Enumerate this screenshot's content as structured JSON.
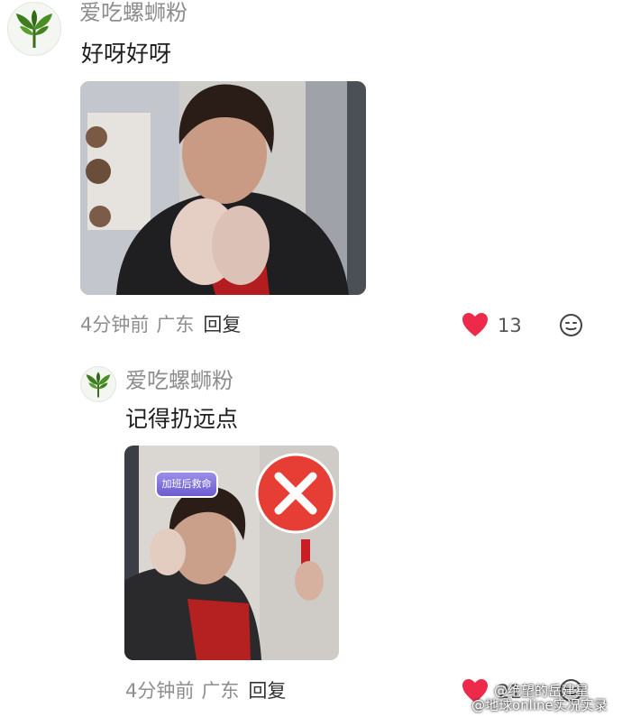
{
  "comments": [
    {
      "username": "爱吃螺蛳粉",
      "text": "好呀好呀",
      "time": "4分钟前",
      "location": "广东",
      "reply_label": "回复",
      "likes": "13"
    },
    {
      "username": "爱吃螺蛳粉",
      "text": "记得扔远点",
      "time": "4分钟前",
      "location": "广东",
      "reply_label": "回复",
      "likes": "21",
      "sticker_banner": "加班后救命"
    }
  ],
  "watermark": {
    "line1": "@绝望的岳建星",
    "line2": "@地球online实况实录"
  },
  "colors": {
    "heart": "#ee2a4a",
    "meta": "#8e8e8e",
    "username": "#8d8d8d"
  },
  "icons": [
    "leaf-avatar-icon",
    "heart-icon",
    "emoji-icon",
    "weibo-icon",
    "cross-sign-icon"
  ]
}
